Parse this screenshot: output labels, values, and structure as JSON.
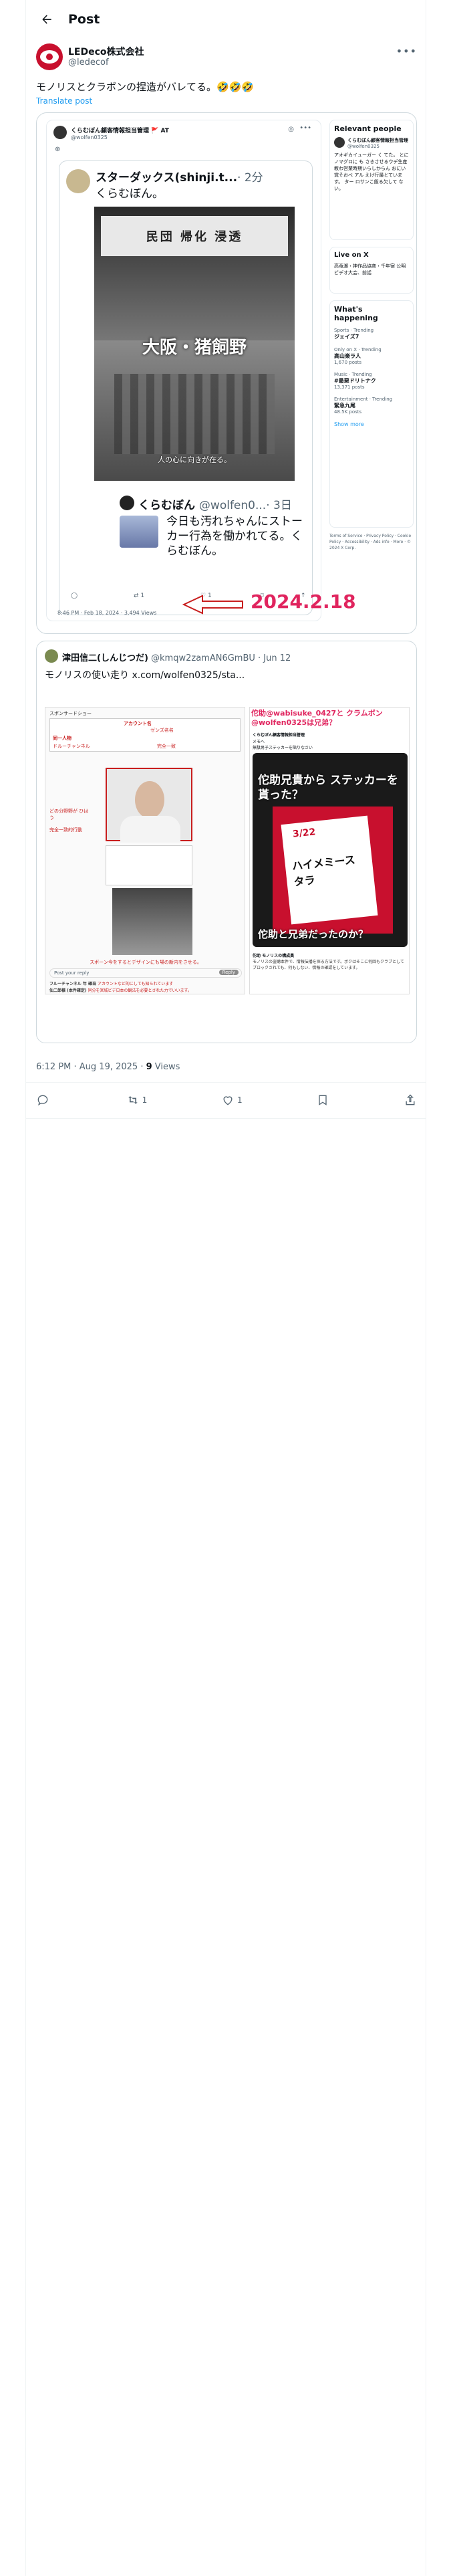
{
  "header": {
    "back_icon": "back-arrow-icon",
    "title": "Post"
  },
  "author": {
    "name": "LEDeco株式会社",
    "handle": "@ledecof",
    "more_icon": "more-icon"
  },
  "tweet": {
    "text": "モノリスとクラボンの捏造がバレてる。🤣🤣🤣",
    "translate": "Translate post"
  },
  "screenshot1": {
    "inner_author": "くらむぼん顧客情報担当管理 🚩 AT",
    "inner_handle": "@wolfen0325",
    "quote_name": "スターダックス(shinji.t...",
    "quote_time": "· 2分",
    "quote_text": "くらむぼん。",
    "photo_banner": "大阪・猪飼野",
    "photo_caption": "人の心に向きが在る。",
    "photo_sign": "民団 帰化 浸透",
    "reply_name": "くらむぼん",
    "reply_handle": "@wolfen0...",
    "reply_time": "· 3日",
    "reply_text": "今日も汚れちゃんにストーカー行為を働かれてる。くらむぼん。",
    "action_reply": "",
    "action_repost": "1",
    "action_like": "1",
    "footer_time": "8:46 PM · Feb 18, 2024 · 3,494 Views",
    "annotation": "2024.2.18",
    "sidebar": {
      "relevant_title": "Relevant people",
      "relevant_name": "くらむぼん顧客情報担当管理",
      "relevant_handle": "@wolfen0325",
      "relevant_bio": "アオギカイューガー く てた。 とにノマグロに も さきさせるウデ生産 教わ営業時期いらしからん おにい覚そおべ アル えけ行最とています。 ター ロサンこ飯る欠して ない。",
      "live_title": "Live on X",
      "live_item": "高竜瀬・神作品協商・千年宿 公明ビデオ大会、前話",
      "happening_title": "What's happening",
      "trends": [
        {
          "cat": "Sports · Trending",
          "name": "ジェイズ7",
          "count": ""
        },
        {
          "cat": "Only on X · Trending",
          "name": "高山楽ラ人",
          "count": "1,670 posts"
        },
        {
          "cat": "Music · Trending",
          "name": "#最悪ドリトナク",
          "count": "13,371 posts"
        },
        {
          "cat": "Entertainment · Trending",
          "name": "緊急九尾",
          "count": "48.5K posts"
        }
      ],
      "show_more": "Show more",
      "footer_links": "Terms of Service · Privacy Policy · Cookie Policy · Accessibility · Ads info · More · © 2024 X Corp."
    }
  },
  "quote_post": {
    "name": "津田信二(しんじつだ)",
    "handle": "@kmqw2zamAN6GmBU",
    "date": "· Jun 12",
    "text": "モノリスの使い走り x.com/wolfen0325/sta...",
    "left_panel": {
      "caption_top": "スポンサードショー",
      "name_label": "アカウント名",
      "name_value": "ゼンズ名名",
      "red_label_1": "同一人物",
      "red_label_2": "ドルーチャンネル",
      "red_note": "完全一致",
      "left_note_1": "どの分野野が ひはう",
      "left_note_2": "完全一致的行動",
      "bottom_caption": "スポーン今をするとデザインにも場の新内をさせる。",
      "reply_placeholder": "Post your reply",
      "reply_button": "Reply",
      "comment1_name": "フルーチャンネル 年 確当",
      "comment1_text": "アカウントなど的にしても知られています",
      "comment2_name": "仙二郎様 (本件確定)",
      "comment2_text": "同分を宮城ビデ日本の観法を必要とされた力でいいます。"
    },
    "right_panel": {
      "red_title": "佗助@wabisuke_0427と クラムボン@wolfen0325は兄弟？",
      "inner_author": "くらむぼん顧客情報担当管理",
      "inner_label": "メモへ",
      "inner_text": "無駄男子ステッカーを貼りなさい",
      "overlay_top": "佗助兄貴から ステッカーを貰った？",
      "overlay_bottom": "佗助と兄弟だったのか？",
      "poster_text": "ハイメミースタラ",
      "poster_date": "3/22",
      "comment_name": "佗助 モノリスの構成員",
      "comment_text": "モノリスの盗聴本件で、情報伝播を探る方法です。ボクはそこに何回もクラブとしてブロックされても、何もしない、情報の確認をしています。"
    }
  },
  "meta": {
    "time": "6:12 PM · Aug 19, 2025 · ",
    "views": "9",
    "views_label": " Views"
  },
  "actions": {
    "reply": "",
    "repost": "1",
    "like": "1",
    "bookmark": "",
    "share": ""
  }
}
